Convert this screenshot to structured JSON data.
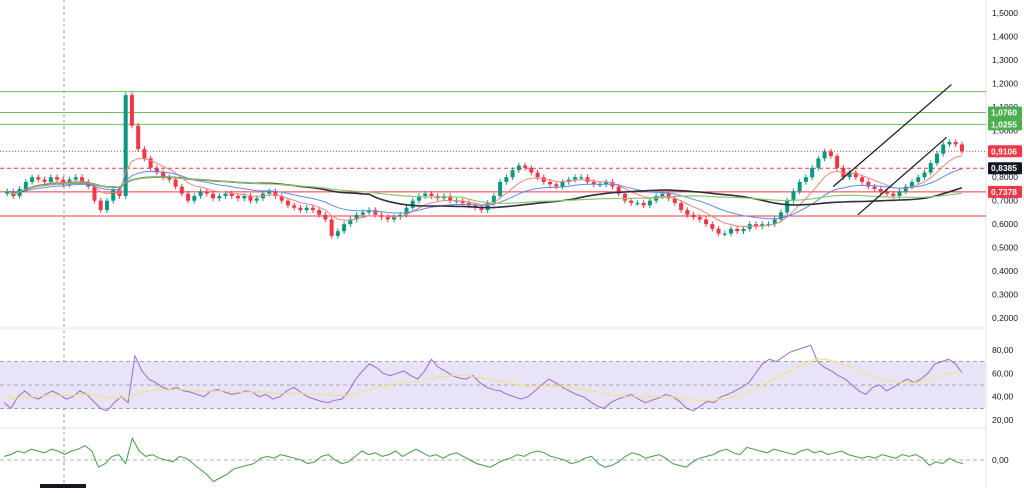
{
  "chart_data": [
    {
      "type": "candlestick",
      "pane": "price",
      "title": "",
      "ylim": [
        0.2,
        1.5
      ],
      "y_ticks": [
        "1,5000",
        "1,4000",
        "1,3000",
        "1,2000",
        "1,1000",
        "1,0000",
        "0,9000",
        "0,8000",
        "0,7000",
        "0,6000",
        "0,5000",
        "0,4000",
        "0,3000",
        "0,2000"
      ],
      "price_badges": [
        {
          "label": "1,0760",
          "value": 1.076,
          "color": "#4caf50"
        },
        {
          "label": "1,0255",
          "value": 1.0255,
          "color": "#4caf50"
        },
        {
          "label": "0,9106",
          "value": 0.9106,
          "color": "#f23645"
        },
        {
          "label": "0,8385",
          "value": 0.8385,
          "color": "#131722"
        },
        {
          "label": "0,7378",
          "value": 0.7378,
          "color": "#f23645"
        }
      ],
      "horizontal_levels": [
        {
          "value": 1.165,
          "color": "#6fbf5f",
          "style": "solid"
        },
        {
          "value": 1.076,
          "color": "#6fbf5f",
          "style": "solid"
        },
        {
          "value": 1.0255,
          "color": "#6fbf5f",
          "style": "solid"
        },
        {
          "value": 0.9106,
          "color": "#f23645",
          "style": "dotted"
        },
        {
          "value": 0.8385,
          "color": "#f23645",
          "style": "dashed"
        },
        {
          "value": 0.7378,
          "color": "#f23645",
          "style": "solid"
        },
        {
          "value": 0.635,
          "color": "#f23645",
          "style": "solid"
        }
      ],
      "channel_lines": [
        {
          "from": [
            0.845,
            0.76
          ],
          "to": [
            0.965,
            1.195
          ]
        },
        {
          "from": [
            0.87,
            0.64
          ],
          "to": [
            0.96,
            0.97
          ]
        }
      ],
      "close_series": [
        0.74,
        0.72,
        0.75,
        0.78,
        0.8,
        0.79,
        0.78,
        0.8,
        0.79,
        0.77,
        0.79,
        0.8,
        0.78,
        0.76,
        0.7,
        0.66,
        0.7,
        0.75,
        0.72,
        1.15,
        1.02,
        0.92,
        0.88,
        0.84,
        0.82,
        0.8,
        0.79,
        0.76,
        0.73,
        0.7,
        0.72,
        0.74,
        0.73,
        0.71,
        0.72,
        0.73,
        0.72,
        0.71,
        0.72,
        0.7,
        0.71,
        0.73,
        0.74,
        0.72,
        0.7,
        0.68,
        0.67,
        0.66,
        0.67,
        0.66,
        0.64,
        0.62,
        0.55,
        0.57,
        0.6,
        0.62,
        0.64,
        0.65,
        0.66,
        0.64,
        0.63,
        0.62,
        0.63,
        0.64,
        0.67,
        0.7,
        0.72,
        0.73,
        0.72,
        0.71,
        0.72,
        0.7,
        0.7,
        0.69,
        0.68,
        0.67,
        0.66,
        0.69,
        0.72,
        0.78,
        0.8,
        0.83,
        0.85,
        0.84,
        0.82,
        0.8,
        0.78,
        0.77,
        0.76,
        0.78,
        0.79,
        0.8,
        0.8,
        0.78,
        0.77,
        0.77,
        0.78,
        0.76,
        0.73,
        0.7,
        0.69,
        0.69,
        0.68,
        0.7,
        0.72,
        0.73,
        0.71,
        0.69,
        0.66,
        0.64,
        0.63,
        0.62,
        0.6,
        0.58,
        0.56,
        0.56,
        0.58,
        0.57,
        0.58,
        0.6,
        0.59,
        0.6,
        0.6,
        0.62,
        0.65,
        0.7,
        0.74,
        0.78,
        0.8,
        0.84,
        0.88,
        0.91,
        0.89,
        0.84,
        0.8,
        0.82,
        0.8,
        0.78,
        0.76,
        0.75,
        0.74,
        0.73,
        0.72,
        0.74,
        0.76,
        0.78,
        0.8,
        0.82,
        0.86,
        0.9,
        0.94,
        0.95,
        0.94,
        0.91
      ]
    },
    {
      "type": "line",
      "pane": "rsi",
      "ylim": [
        15,
        85
      ],
      "y_ticks": [
        "80,00",
        "60,00",
        "40,00",
        "20,00"
      ],
      "bands": [
        70,
        50,
        30
      ],
      "fill_color": "#e9e3f7",
      "series": [
        {
          "values": [
            35,
            30,
            40,
            45,
            40,
            38,
            42,
            45,
            42,
            38,
            40,
            45,
            42,
            36,
            30,
            28,
            35,
            40,
            35,
            75,
            62,
            55,
            52,
            48,
            46,
            48,
            45,
            44,
            42,
            40,
            45,
            46,
            44,
            42,
            43,
            45,
            44,
            40,
            42,
            38,
            40,
            45,
            48,
            44,
            40,
            38,
            36,
            35,
            37,
            38,
            45,
            55,
            62,
            68,
            65,
            60,
            58,
            60,
            62,
            58,
            55,
            62,
            72,
            65,
            62,
            58,
            56,
            55,
            58,
            52,
            48,
            46,
            45,
            42,
            40,
            38,
            40,
            45,
            50,
            55,
            52,
            48,
            45,
            42,
            40,
            36,
            32,
            30,
            35,
            38,
            40,
            42,
            38,
            35,
            37,
            39,
            42,
            40,
            36,
            30,
            28,
            32,
            36,
            35,
            40,
            42,
            45,
            48,
            52,
            60,
            68,
            72,
            70,
            74,
            78,
            80,
            82,
            84,
            70,
            65,
            62,
            58,
            55,
            50,
            45,
            42,
            48,
            50,
            45,
            48,
            52,
            55,
            52,
            55,
            60,
            68,
            70,
            72,
            68,
            60
          ],
          "color": "#9c6ad6"
        },
        {
          "values": [
            40,
            39,
            39,
            40,
            40,
            40,
            41,
            41,
            41,
            41,
            41,
            42,
            42,
            41,
            40,
            39,
            39,
            39,
            39,
            42,
            44,
            45,
            46,
            46,
            46,
            46,
            46,
            46,
            45,
            45,
            45,
            45,
            45,
            44,
            44,
            44,
            44,
            44,
            44,
            43,
            43,
            43,
            43,
            43,
            43,
            42,
            42,
            41,
            41,
            41,
            41,
            42,
            44,
            46,
            48,
            49,
            50,
            51,
            52,
            53,
            53,
            54,
            56,
            57,
            57,
            58,
            58,
            58,
            57,
            56,
            55,
            54,
            53,
            52,
            51,
            50,
            49,
            49,
            49,
            49,
            49,
            49,
            48,
            47,
            46,
            45,
            44,
            42,
            41,
            41,
            40,
            40,
            40,
            40,
            40,
            40,
            40,
            40,
            39,
            38,
            37,
            37,
            37,
            37,
            38,
            39,
            40,
            42,
            44,
            47,
            50,
            53,
            56,
            59,
            62,
            65,
            68,
            71,
            72,
            72,
            71,
            69,
            67,
            65,
            62,
            59,
            57,
            56,
            54,
            53,
            52,
            52,
            52,
            53,
            54,
            56,
            58,
            60,
            61,
            61
          ],
          "color": "#f0e27a"
        }
      ]
    },
    {
      "type": "line",
      "pane": "momentum",
      "y_ticks": [
        "0,00"
      ],
      "series": [
        {
          "values": [
            0.02,
            0.03,
            0.05,
            0.04,
            0.06,
            0.05,
            0.04,
            0.06,
            0.05,
            0.03,
            0.05,
            0.06,
            0.08,
            0.05,
            -0.04,
            -0.02,
            0.02,
            0.03,
            -0.02,
            0.12,
            0.05,
            0.02,
            0.03,
            0.01,
            0,
            -0.01,
            0.02,
            0.01,
            -0.02,
            -0.05,
            -0.08,
            -0.12,
            -0.1,
            -0.08,
            -0.05,
            -0.04,
            -0.03,
            -0.02,
            0.01,
            0.02,
            0.01,
            0.03,
            0.02,
            0.01,
            0,
            -0.02,
            -0.01,
            0.02,
            0.03,
            0,
            -0.02,
            -0.01,
            0.02,
            0.05,
            0.03,
            0.04,
            0.02,
            0.03,
            0.05,
            0.02,
            0.04,
            0.06,
            0.04,
            0.02,
            0.03,
            0.01,
            0.03,
            0.04,
            0.02,
            0,
            -0.02,
            -0.03,
            -0.04,
            -0.02,
            0,
            0.01,
            0.03,
            0.02,
            0.04,
            0.05,
            0.04,
            0.02,
            0.01,
            0,
            -0.02,
            -0.01,
            0.01,
            0.02,
            -0.02,
            -0.04,
            -0.03,
            -0.01,
            0.02,
            0.04,
            0.03,
            0.01,
            0.02,
            0.03,
            0.01,
            -0.02,
            -0.03,
            -0.04,
            -0.01,
            0.01,
            0.02,
            0.03,
            0.05,
            0.06,
            0.04,
            0.03,
            0.07,
            0.06,
            0.05,
            0.04,
            0.06,
            0.05,
            0.04,
            0.03,
            0.05,
            0.06,
            0.04,
            0.05,
            0.03,
            0.04,
            0.05,
            0.03,
            0.02,
            0.01,
            0.02,
            0.01,
            0.03,
            0.02,
            0.01,
            0.03,
            0.02,
            0.03,
            0.01,
            -0.03,
            -0.01,
            -0.02,
            0.01,
            -0.01,
            -0.02
          ],
          "color": "#3f9f3f"
        }
      ]
    }
  ],
  "colors": {
    "up": "#089981",
    "down": "#f23645",
    "ema_fast": "#f4837d",
    "ema_mid": "#5b8def",
    "ema_slow": "#2f2f3a",
    "ema_long": "#8fc76a"
  }
}
